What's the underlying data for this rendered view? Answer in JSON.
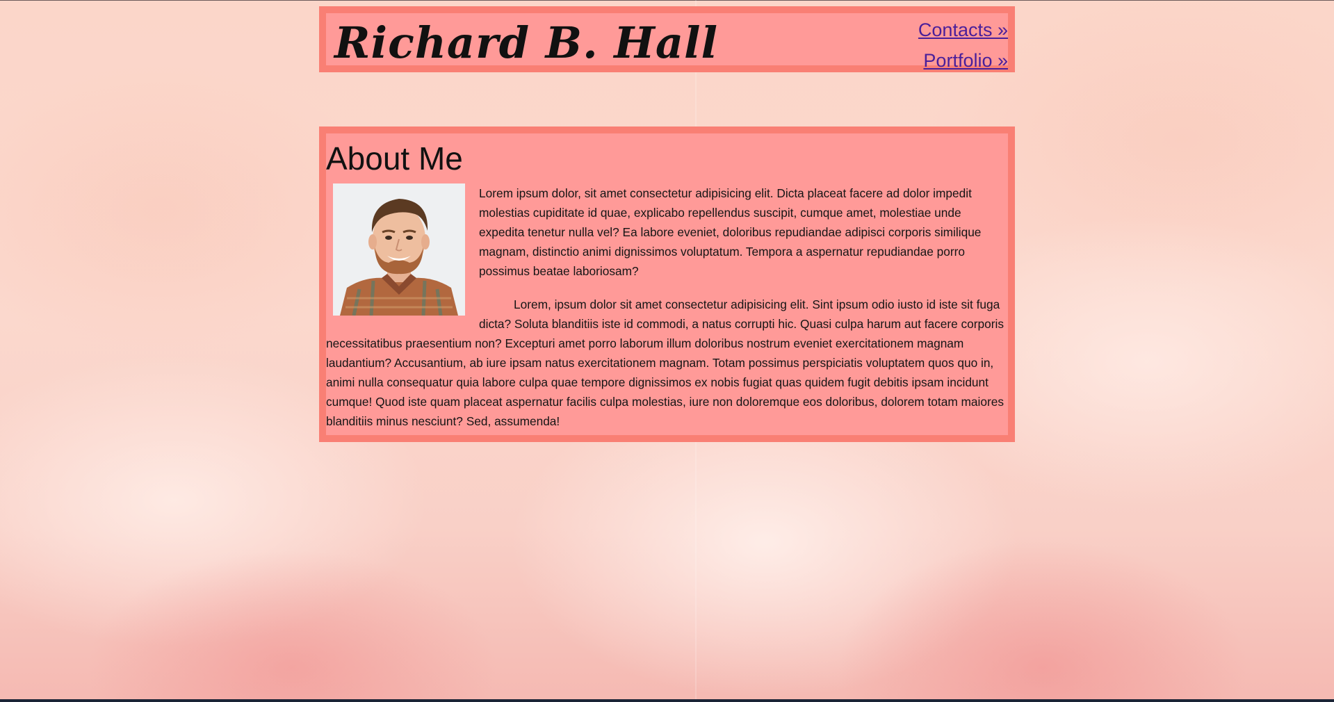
{
  "header": {
    "title": "Richard B. Hall",
    "nav": [
      {
        "label": "Contacts »"
      },
      {
        "label": "Portfolio »"
      }
    ]
  },
  "about": {
    "heading": "About Me",
    "paragraphs": [
      "Lorem ipsum dolor, sit amet consectetur adipisicing elit. Dicta placeat facere ad dolor impedit molestias cupiditate id quae, explicabo repellendus suscipit, cumque amet, molestiae unde expedita tenetur nulla vel? Ea labore eveniet, doloribus repudiandae adipisci corporis similique magnam, distinctio animi dignissimos voluptatum. Tempora a aspernatur repudiandae porro possimus beatae laboriosam?",
      "Lorem, ipsum dolor sit amet consectetur adipisicing elit. Sint ipsum odio iusto id iste sit fuga dicta? Soluta blanditiis iste id commodi, a natus corrupti hic. Quasi culpa harum aut facere corporis necessitatibus praesentium non? Excepturi amet porro laborum illum doloribus nostrum eveniet exercitationem magnam laudantium? Accusantium, ab iure ipsam natus exercitationem magnam. Totam possimus perspiciatis voluptatem quos quo in, animi nulla consequatur quia labore culpa quae tempore dignissimos ex nobis fugiat quas quidem fugit debitis ipsam incidunt cumque! Quod iste quam placeat aspernatur facilis culpa molestias, iure non doloremque eos doloribus, dolorem totam maiores blanditiis minus nesciunt? Sed, assumenda!"
    ]
  },
  "colors": {
    "box_fill": "#ff9a98",
    "box_border": "#f97f74",
    "link": "#4a1f9a"
  }
}
